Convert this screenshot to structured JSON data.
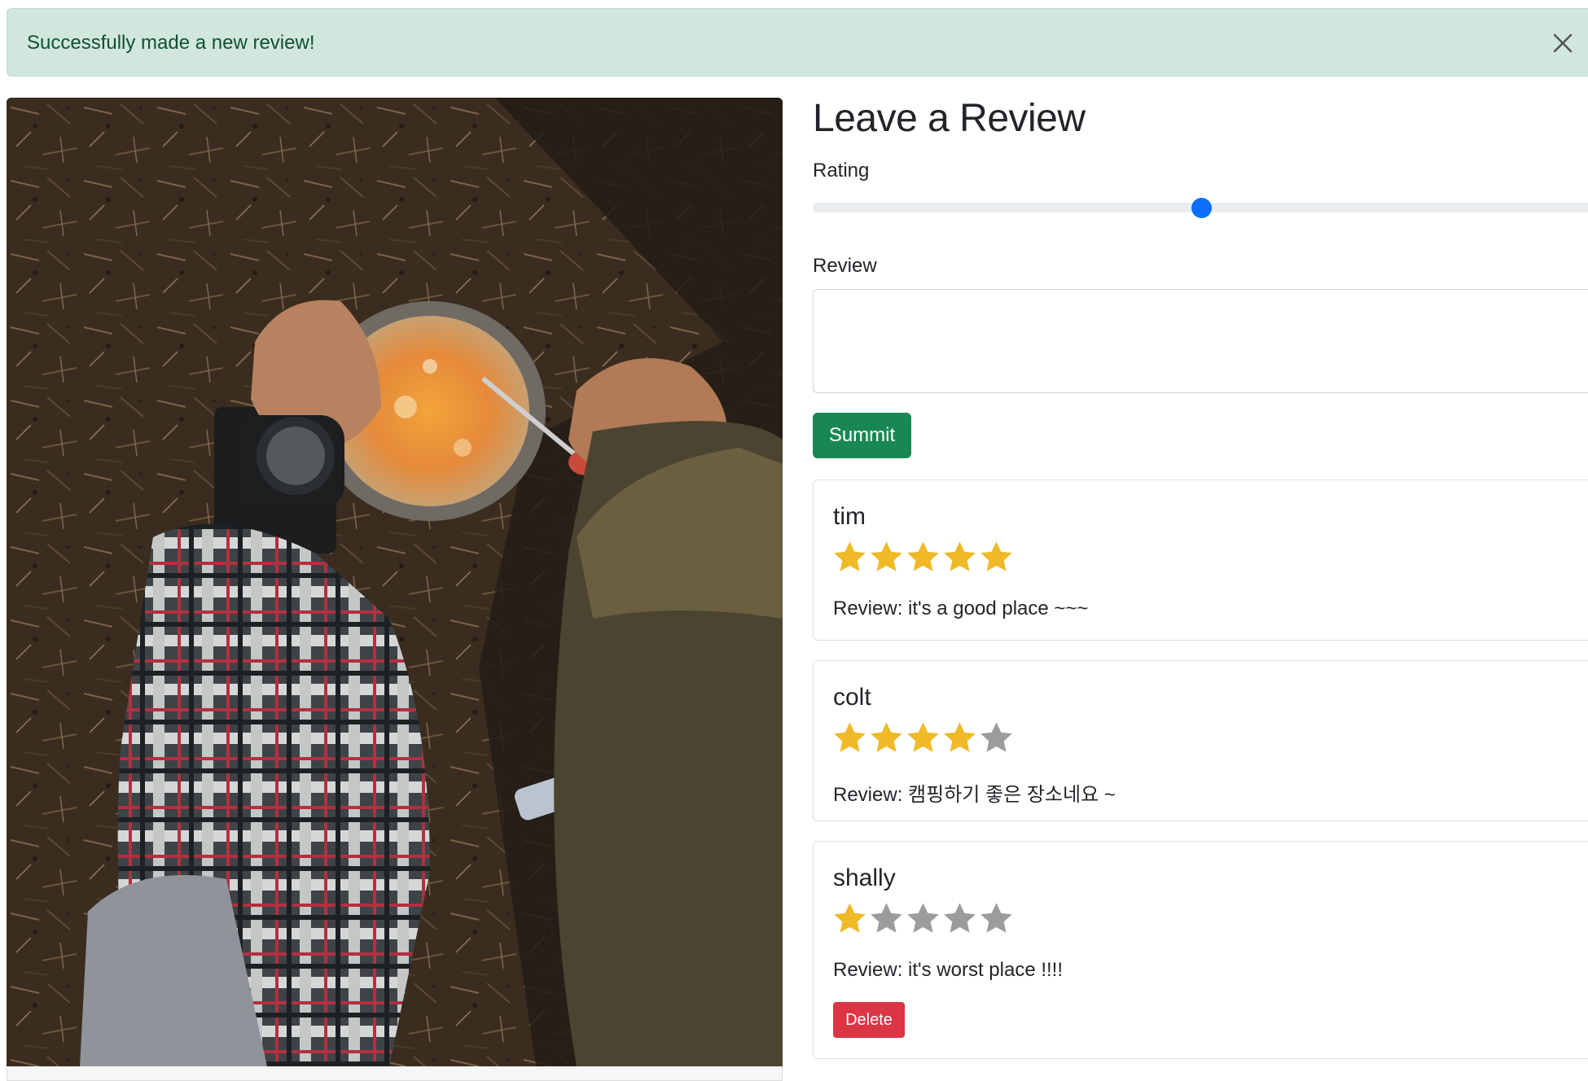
{
  "alert": {
    "message": "Successfully made a new review!",
    "close_icon": "close-icon",
    "color": "#d1e7dd"
  },
  "photo": {
    "subject": "camp-cooking-photo"
  },
  "form": {
    "title": "Leave a Review",
    "rating_label": "Rating",
    "rating_value": 3,
    "rating_min": 1,
    "rating_max": 5,
    "review_label": "Review",
    "review_value": "",
    "submit_label": "Summit",
    "submit_color": "#198754"
  },
  "reviews": [
    {
      "author": "tim",
      "rating": 5,
      "prefix": "Review:",
      "body": "it's a good place ~~~",
      "delete_label": ""
    },
    {
      "author": "colt",
      "rating": 4,
      "prefix": "Review:",
      "body": "캠핑하기 좋은 장소네요 ~",
      "delete_label": ""
    },
    {
      "author": "shally",
      "rating": 1,
      "prefix": "Review:",
      "body": "it's worst place !!!!",
      "delete_label": "Delete"
    }
  ],
  "colors": {
    "star_filled": "#f0b928",
    "star_empty": "#9c9c9c",
    "danger": "#dc3545",
    "primary": "#0d6efd"
  }
}
